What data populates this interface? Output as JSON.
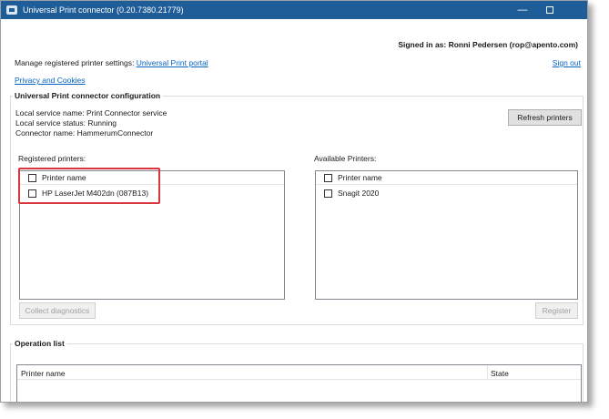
{
  "window": {
    "title": "Universal Print connector (0.20.7380.21779)"
  },
  "account": {
    "signed_in_label": "Signed in as: Ronni Pedersen (rop@apento.com)",
    "sign_out": "Sign out"
  },
  "manage": {
    "label": "Manage registered printer settings:",
    "portal_link": "Universal Print portal"
  },
  "privacy_link": "Privacy and Cookies",
  "config": {
    "title": "Universal Print connector configuration",
    "service_name": "Local service name: Print Connector service",
    "service_status": "Local service status: Running",
    "connector_name": "Connector name: HammerumConnector",
    "refresh_button": "Refresh printers"
  },
  "registered": {
    "label": "Registered printers:",
    "header": "Printer name",
    "rows": [
      "HP LaserJet M402dn (087B13)"
    ],
    "collect_button": "Collect diagnostics"
  },
  "available": {
    "label": "Available Printers:",
    "header": "Printer name",
    "rows": [
      "Snagit 2020"
    ],
    "register_button": "Register"
  },
  "operations": {
    "title": "Operation list",
    "col_printer": "Printer name",
    "col_state": "State"
  }
}
